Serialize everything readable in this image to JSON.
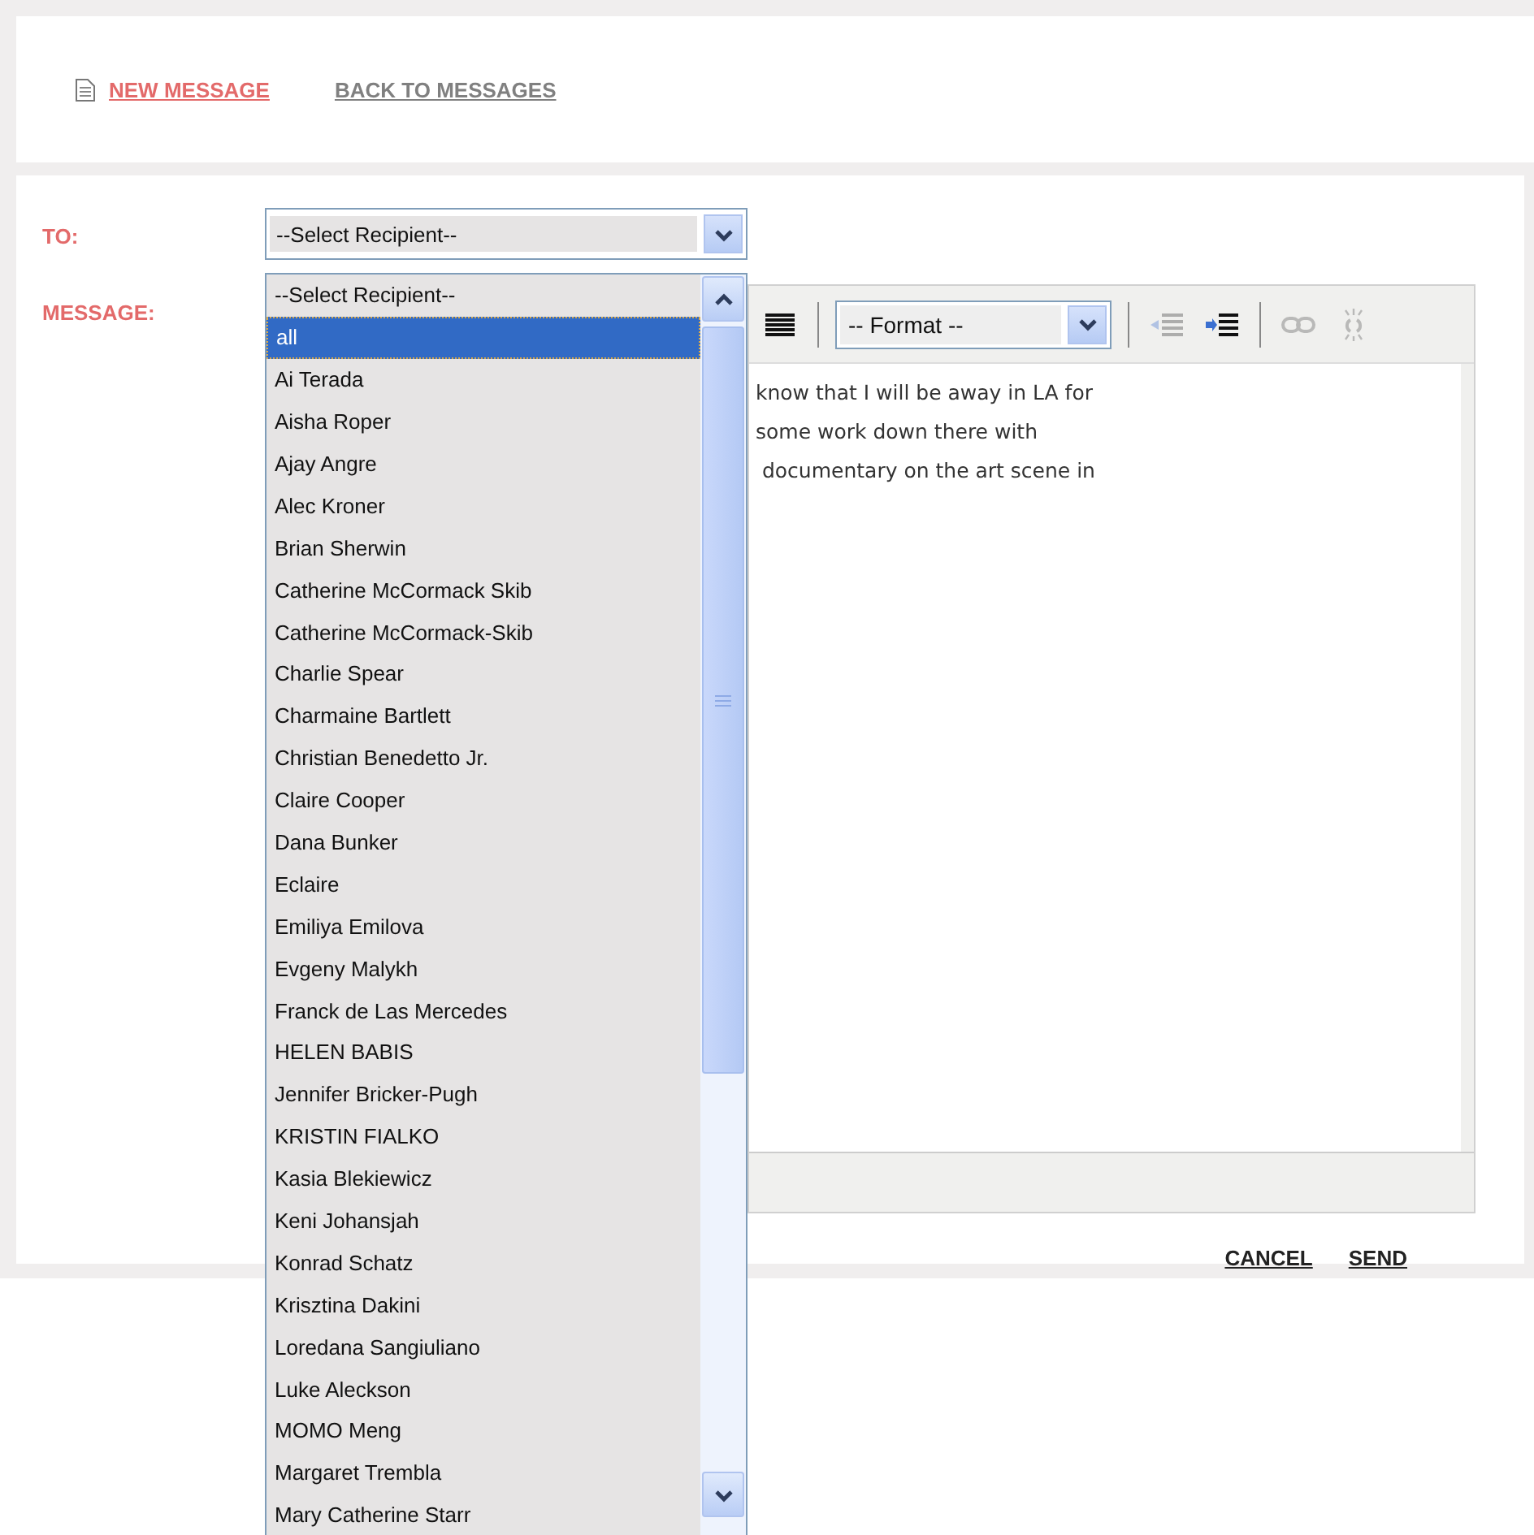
{
  "header_links": [
    {
      "kind": "new",
      "label": "NEW MESSAGE",
      "selected": true
    },
    {
      "kind": "back",
      "label": "BACK TO MESSAGES",
      "selected": false
    }
  ],
  "to_label": "TO:",
  "message_label": "MESSAGE:",
  "recipient_select": {
    "value": "--Select Recipient--",
    "expanded": true,
    "options": [
      {
        "label": "--Select Recipient--",
        "highlighted": false
      },
      {
        "label": "all",
        "highlighted": true
      },
      {
        "label": "Ai Terada",
        "highlighted": false
      },
      {
        "label": "Aisha Roper",
        "highlighted": false
      },
      {
        "label": "Ajay Angre",
        "highlighted": false
      },
      {
        "label": "Alec Kroner",
        "highlighted": false
      },
      {
        "label": "Brian Sherwin",
        "highlighted": false
      },
      {
        "label": "Catherine McCormack Skib",
        "highlighted": false
      },
      {
        "label": "Catherine McCormack-Skib",
        "highlighted": false
      },
      {
        "label": "Charlie Spear",
        "highlighted": false
      },
      {
        "label": "Charmaine Bartlett",
        "highlighted": false
      },
      {
        "label": "Christian Benedetto Jr.",
        "highlighted": false
      },
      {
        "label": "Claire Cooper",
        "highlighted": false
      },
      {
        "label": "Dana Bunker",
        "highlighted": false
      },
      {
        "label": "Eclaire",
        "highlighted": false
      },
      {
        "label": "Emiliya Emilova",
        "highlighted": false
      },
      {
        "label": "Evgeny Malykh",
        "highlighted": false
      },
      {
        "label": "Franck de Las Mercedes",
        "highlighted": false
      },
      {
        "label": "HELEN BABIS",
        "highlighted": false
      },
      {
        "label": "Jennifer Bricker-Pugh",
        "highlighted": false
      },
      {
        "label": "KRISTIN FIALKO",
        "highlighted": false
      },
      {
        "label": "Kasia Blekiewicz",
        "highlighted": false
      },
      {
        "label": "Keni Johansjah",
        "highlighted": false
      },
      {
        "label": "Konrad Schatz",
        "highlighted": false
      },
      {
        "label": "Krisztina Dakini",
        "highlighted": false
      },
      {
        "label": "Loredana Sangiuliano",
        "highlighted": false
      },
      {
        "label": "Luke Aleckson",
        "highlighted": false
      },
      {
        "label": "MOMO Meng",
        "highlighted": false
      },
      {
        "label": "Margaret Trembla",
        "highlighted": false
      },
      {
        "label": "Mary Catherine Starr",
        "highlighted": false
      }
    ]
  },
  "toolbar": [
    {
      "kind": "justify",
      "disabled": false
    },
    {
      "kind": "separator"
    },
    {
      "kind": "format",
      "label": "-- Format --"
    },
    {
      "kind": "separator"
    },
    {
      "kind": "outdent",
      "disabled": true
    },
    {
      "kind": "indent",
      "disabled": false
    },
    {
      "kind": "separator"
    },
    {
      "kind": "link",
      "disabled": true
    },
    {
      "kind": "unlink",
      "disabled": true
    }
  ],
  "message_lines": [
    "know that I will be away in LA for",
    "some work down there with",
    " documentary on the art scene in"
  ],
  "actions": [
    {
      "label": "CANCEL"
    },
    {
      "label": "SEND"
    }
  ]
}
